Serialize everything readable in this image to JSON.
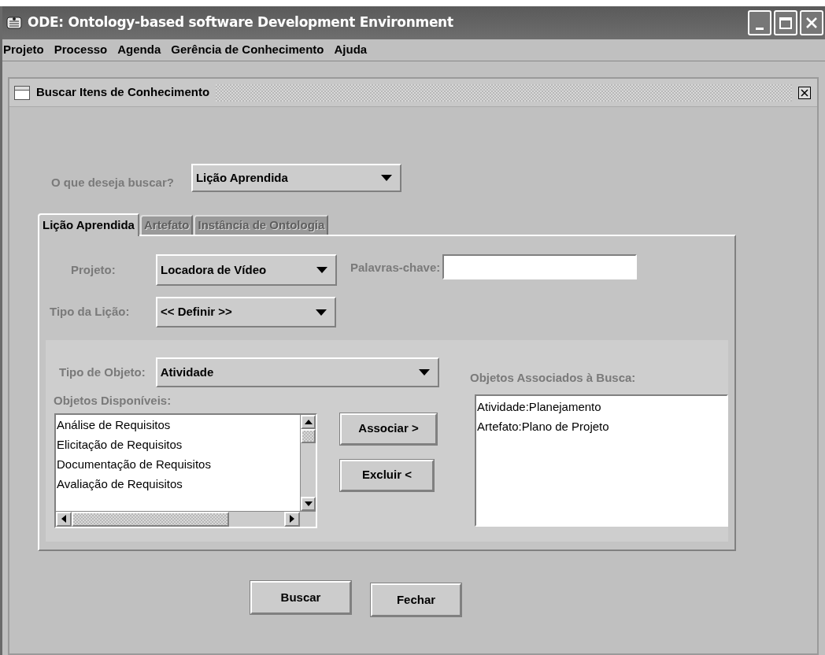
{
  "window": {
    "title": "ODE: Ontology-based software Development Environment"
  },
  "menu": [
    "Projeto",
    "Processo",
    "Agenda",
    "Gerência de Conhecimento",
    "Ajuda"
  ],
  "dialog": {
    "title": "Buscar Itens de Conhecimento"
  },
  "search_type": {
    "label": "O que deseja buscar?",
    "value": "Lição Aprendida"
  },
  "tabs": [
    {
      "label": "Lição Aprendida",
      "selected": true
    },
    {
      "label": "Artefato",
      "selected": false
    },
    {
      "label": "Instância de Ontologia",
      "selected": false
    }
  ],
  "projeto": {
    "label": "Projeto:",
    "value": "Locadora de Vídeo"
  },
  "palavras_chave": {
    "label": "Palavras-chave:"
  },
  "tipo_licao": {
    "label": "Tipo da Lição:",
    "value": "<< Definir >>"
  },
  "tipo_objeto": {
    "label": "Tipo de Objeto:",
    "value": "Atividade"
  },
  "disponiveis": {
    "label": "Objetos Disponíveis:",
    "items": [
      "Análise de Requisitos",
      "Elicitação de Requisitos",
      "Documentação de Requisitos",
      "Avaliação de Requisitos"
    ]
  },
  "transfer_buttons": [
    "Associar >",
    "Excluir <"
  ],
  "associados": {
    "label": "Objetos Associados à Busca:",
    "items": [
      "Atividade:Planejamento",
      "Artefato:Plano de Projeto"
    ]
  },
  "buttons": [
    "Buscar",
    "Fechar"
  ]
}
